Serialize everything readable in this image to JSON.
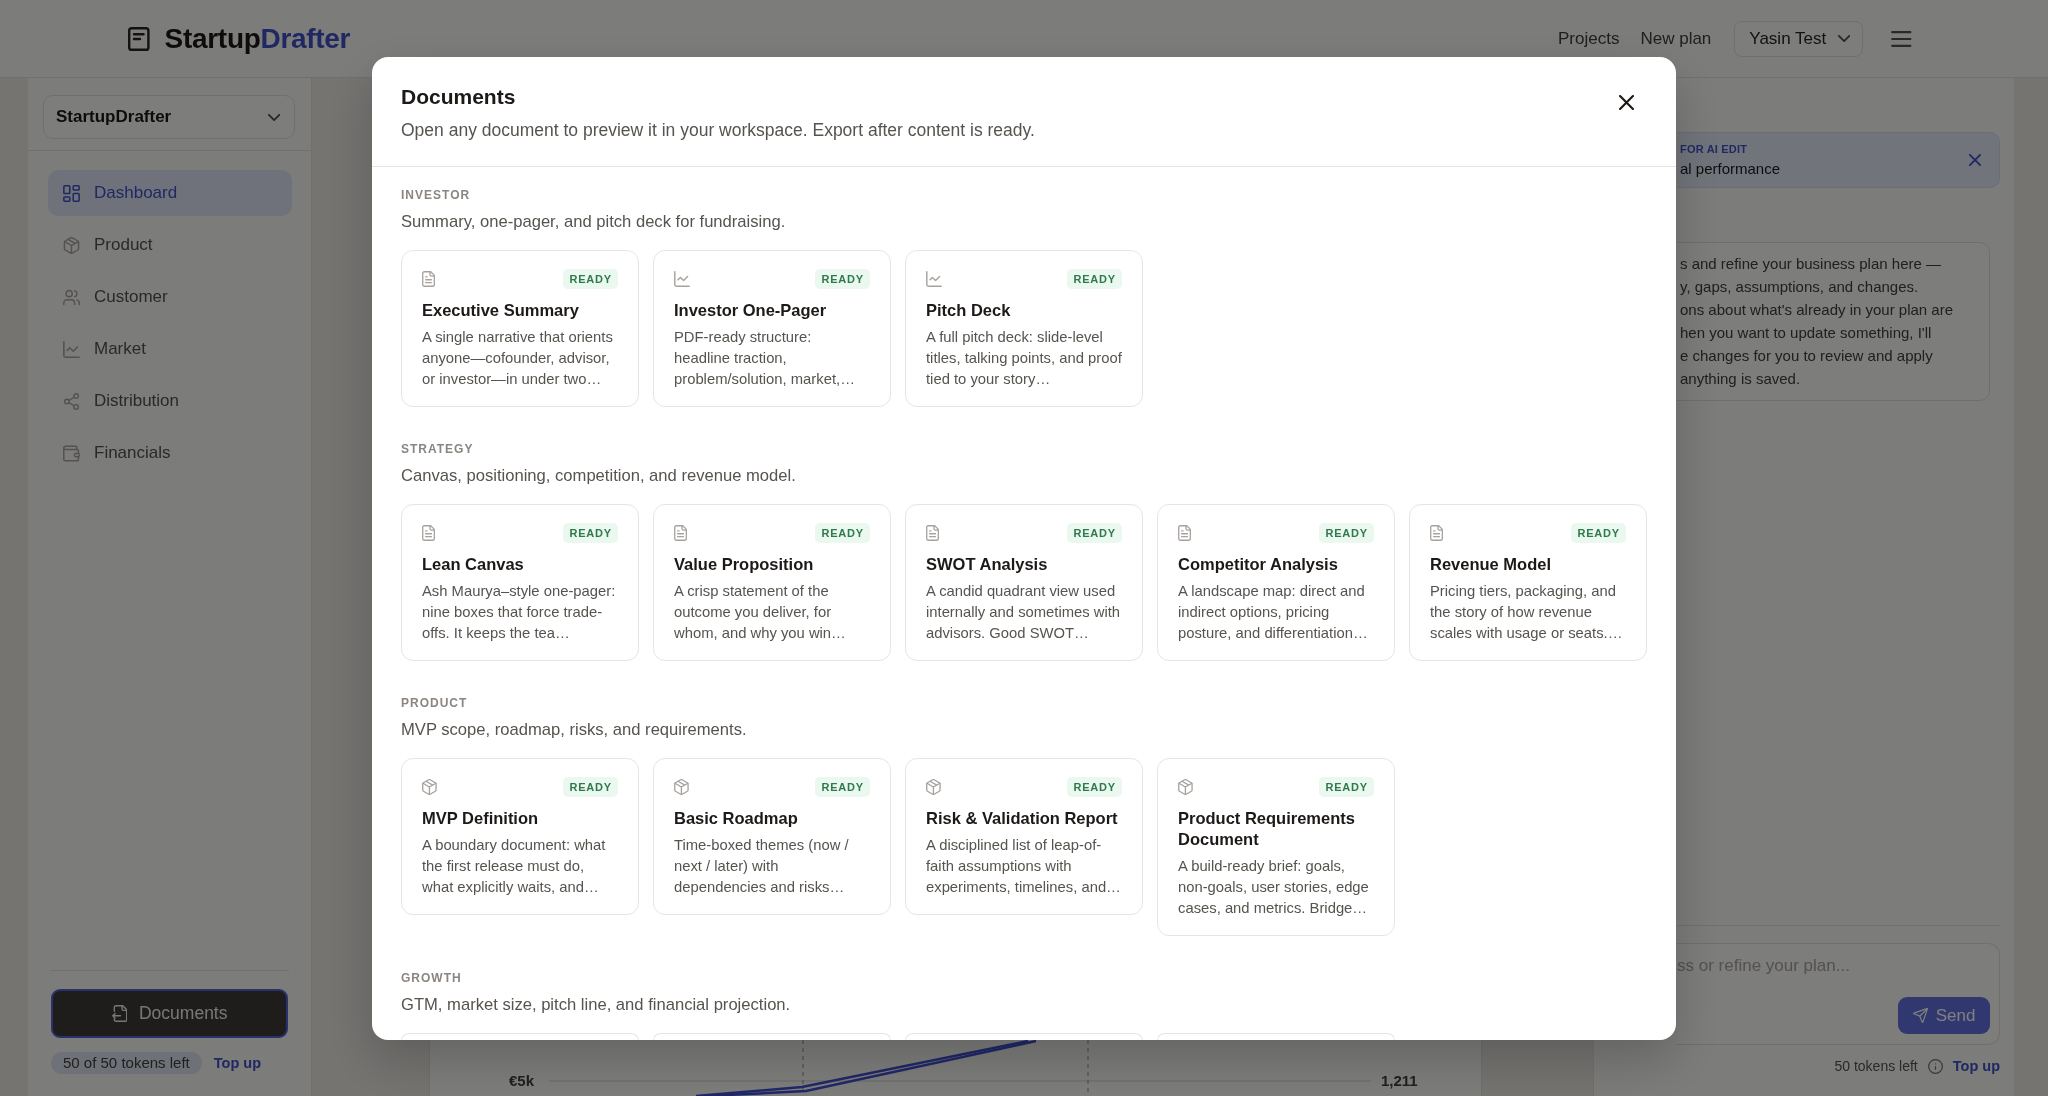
{
  "header": {
    "brand": {
      "name_start": "Startup",
      "name_end": "Drafter"
    },
    "links": [
      "Projects",
      "New plan"
    ],
    "user_menu": "Yasin Test"
  },
  "sidebar": {
    "project_select": "StartupDrafter",
    "items": [
      {
        "label": "Dashboard",
        "selected": true
      },
      {
        "label": "Product",
        "selected": false
      },
      {
        "label": "Customer",
        "selected": false
      },
      {
        "label": "Market",
        "selected": false
      },
      {
        "label": "Distribution",
        "selected": false
      },
      {
        "label": "Financials",
        "selected": false
      }
    ],
    "documents_button": "Documents",
    "tokens": "50 of 50 tokens left",
    "top_up_link": "Top up"
  },
  "dashboard_chart": {
    "tick_label": "€5k",
    "end_label": "1,211"
  },
  "assistant_panel": {
    "context_banner": {
      "tag": "FOR AI EDIT",
      "text": "al performance"
    },
    "message_lines": [
      "s and refine your business plan here —",
      "y, gaps, assumptions, and changes.",
      "ons about what's already in your plan are",
      "hen you want to update something, I'll",
      "e changes for you to review and apply",
      "anything is saved."
    ],
    "composer": {
      "placeholder": "ss or refine your plan...",
      "send_button": {
        "label": "Send",
        "disabled": true
      }
    },
    "footer": {
      "tokens": "50 tokens left",
      "link": "Top up"
    }
  },
  "documents_dialog": {
    "title": "Documents",
    "subtitle": "Open any document to preview it in your workspace. Export after content is ready.",
    "sections": [
      {
        "label": "INVESTOR",
        "description": "Summary, one-pager, and pitch deck for fundraising.",
        "cards": [
          {
            "kind": "document",
            "title": "Executive Summary",
            "status": "READY",
            "description": "A single narrative that orients anyone—cofounder, advisor, or investor—in under two…"
          },
          {
            "kind": "chart",
            "title": "Investor One-Pager",
            "status": "READY",
            "description": "PDF-ready structure: headline traction, problem/solution, market,…"
          },
          {
            "kind": "chart",
            "title": "Pitch Deck",
            "status": "READY",
            "description": "A full pitch deck: slide-level titles, talking points, and proof tied to your story…"
          }
        ]
      },
      {
        "label": "STRATEGY",
        "description": "Canvas, positioning, competition, and revenue model.",
        "cards": [
          {
            "kind": "document",
            "title": "Lean Canvas",
            "status": "READY",
            "description": "Ash Maurya–style one-pager: nine boxes that force trade-offs. It keeps the tea…"
          },
          {
            "kind": "document",
            "title": "Value Proposition",
            "status": "READY",
            "description": "A crisp statement of the outcome you deliver, for whom, and why you win…"
          },
          {
            "kind": "document",
            "title": "SWOT Analysis",
            "status": "READY",
            "description": "A candid quadrant view used internally and sometimes with advisors. Good SWOT…"
          },
          {
            "kind": "document",
            "title": "Competitor Analysis",
            "status": "READY",
            "description": "A landscape map: direct and indirect options, pricing posture, and differentiation…"
          },
          {
            "kind": "document",
            "title": "Revenue Model",
            "status": "READY",
            "description": "Pricing tiers, packaging, and the story of how revenue scales with usage or seats.…"
          }
        ]
      },
      {
        "label": "PRODUCT",
        "description": "MVP scope, roadmap, risks, and requirements.",
        "cards": [
          {
            "kind": "product",
            "title": "MVP Definition",
            "status": "READY",
            "description": "A boundary document: what the first release must do, what explicitly waits, and…"
          },
          {
            "kind": "product",
            "title": "Basic Roadmap",
            "status": "READY",
            "description": "Time-boxed themes (now / next / later) with dependencies and risks…"
          },
          {
            "kind": "product",
            "title": "Risk & Validation Report",
            "status": "READY",
            "description": "A disciplined list of leap-of-faith assumptions with experiments, timelines, and…"
          },
          {
            "kind": "product",
            "title": "Product Requirements Document",
            "status": "READY",
            "description": "A build-ready brief: goals, non-goals, user stories, edge cases, and metrics. Bridge…"
          }
        ]
      },
      {
        "label": "GROWTH",
        "description": "GTM, market size, pitch line, and financial projection.",
        "cards": [
          {
            "kind": "clipped"
          },
          {
            "kind": "clipped"
          },
          {
            "kind": "clipped"
          },
          {
            "kind": "clipped"
          }
        ]
      }
    ]
  }
}
